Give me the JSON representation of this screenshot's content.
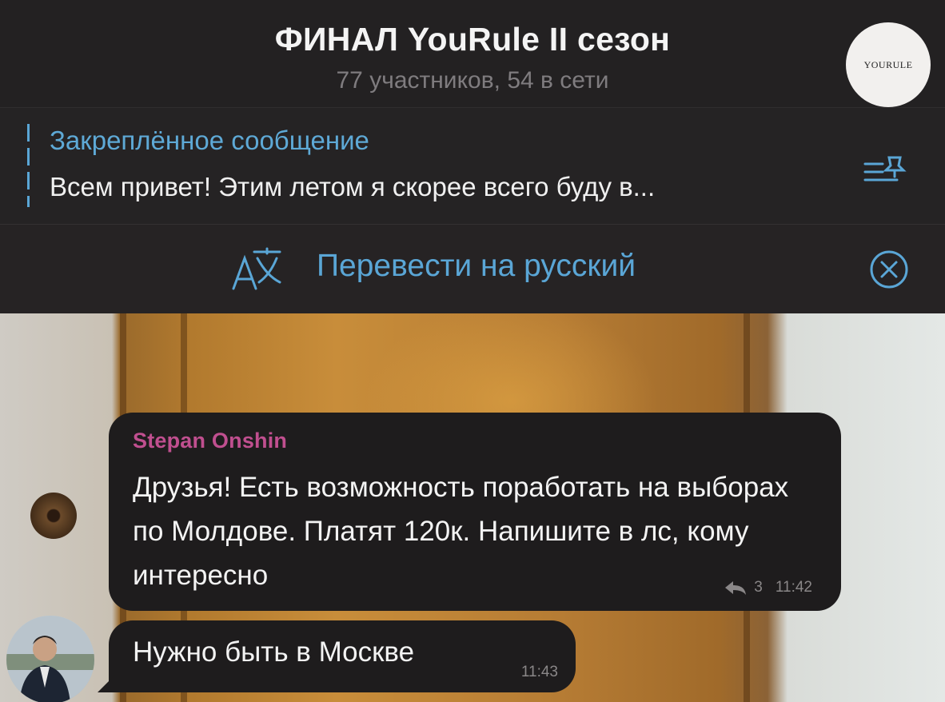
{
  "header": {
    "title": "ФИНАЛ YouRule II сезон",
    "subtitle": "77 участников, 54 в сети",
    "avatar_logo_text": "YOURULE"
  },
  "pinned": {
    "title": "Закреплённое сообщение",
    "text": "Всем привет! Этим летом я скорее всего буду в...",
    "icon": "pin-list-icon"
  },
  "translate_bar": {
    "label": "Перевести на русский",
    "icon": "translate-icon",
    "close_icon": "close-circle-icon"
  },
  "messages": [
    {
      "sender": "Stepan Onshin",
      "text": "Друзья! Есть возможность поработать на выборах по Молдове. Платят 120к. Напишите в лс, кому интересно",
      "replies": "3",
      "time": "11:42"
    },
    {
      "text": "Нужно быть в Москве",
      "time": "11:43"
    }
  ],
  "colors": {
    "accent": "#5aa6d6",
    "sender_name": "#c04f8f",
    "bubble": "#1e1c1d",
    "header_bg": "#232122"
  }
}
